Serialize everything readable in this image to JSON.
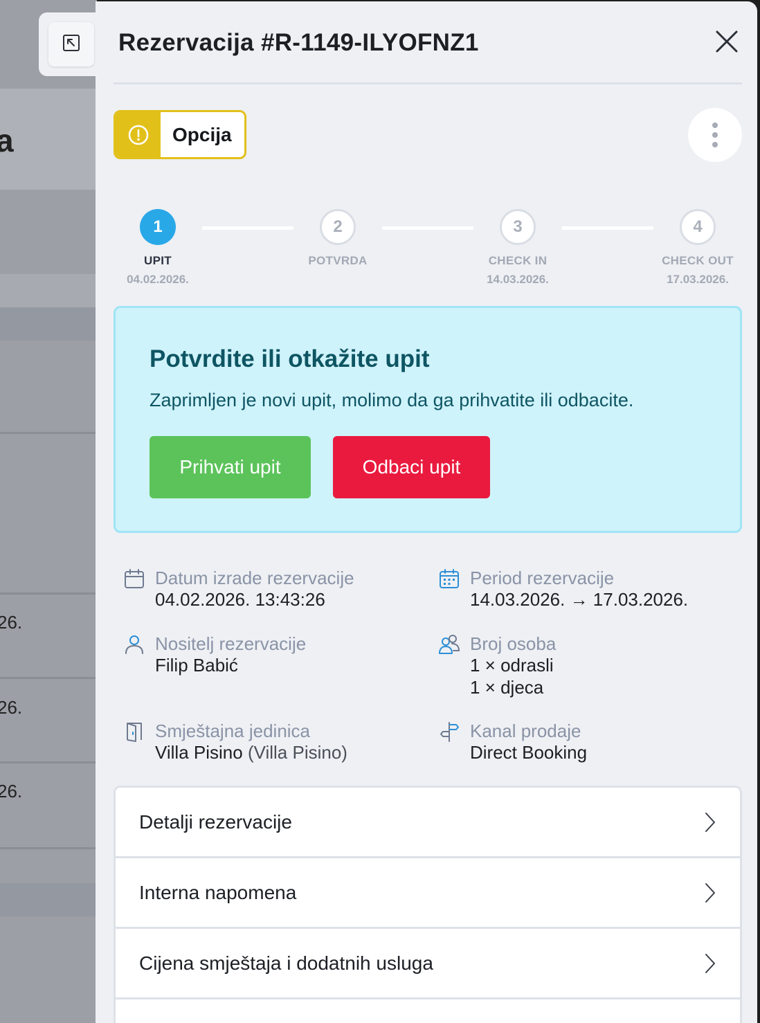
{
  "backdrop": {
    "title_fragment": "a",
    "dates": [
      "26.",
      "26.",
      "26."
    ]
  },
  "header": {
    "title": "Rezervacija #R-1149-ILYOFNZ1",
    "expand_icon": "expand-arrow-icon",
    "close_icon": "close-icon"
  },
  "status": {
    "label": "Opcija",
    "color": "#e2c01a",
    "icon": "alert-circle-icon"
  },
  "stepper": {
    "steps": [
      {
        "number": "1",
        "label": "UPIT",
        "date": "04.02.2026.",
        "active": true
      },
      {
        "number": "2",
        "label": "POTVRDA",
        "date": "",
        "active": false
      },
      {
        "number": "3",
        "label": "CHECK IN",
        "date": "14.03.2026.",
        "active": false
      },
      {
        "number": "4",
        "label": "CHECK OUT",
        "date": "17.03.2026.",
        "active": false
      }
    ],
    "active_color": "#29a8e8"
  },
  "action_card": {
    "title": "Potvrdite ili otkažite upit",
    "description": "Zaprimljen je novi upit, molimo da ga prihvatite ili odbacite.",
    "accept_label": "Prihvati upit",
    "reject_label": "Odbaci upit",
    "accept_color": "#5bc35a",
    "reject_color": "#ea1a3f"
  },
  "info": {
    "created": {
      "label": "Datum izrade rezervacije",
      "value": "04.02.2026. 13:43:26",
      "icon": "calendar-icon"
    },
    "period": {
      "label": "Period rezervacije",
      "value": "14.03.2026. → 17.03.2026.",
      "icon": "calendar-grid-icon"
    },
    "holder": {
      "label": "Nositelj rezervacije",
      "value": "Filip Babić",
      "icon": "user-icon"
    },
    "guests": {
      "label": "Broj osoba",
      "adults": "1 × odrasli",
      "children": "1 × djeca",
      "icon": "users-icon"
    },
    "unit": {
      "label": "Smještajna jedinica",
      "value": "Villa Pisino",
      "value_secondary": "(Villa Pisino)",
      "icon": "door-icon"
    },
    "channel": {
      "label": "Kanal prodaje",
      "value": "Direct Booking",
      "icon": "signpost-icon"
    }
  },
  "sections": [
    {
      "label": "Detalji rezervacije"
    },
    {
      "label": "Interna napomena"
    },
    {
      "label": "Cijena smještaja i dodatnih usluga"
    },
    {
      "label": ""
    }
  ]
}
